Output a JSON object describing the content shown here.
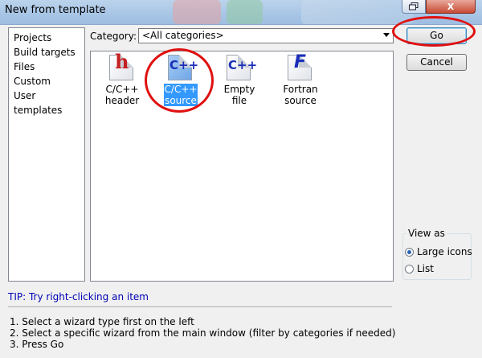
{
  "window": {
    "title": "New from template",
    "close_label": "X"
  },
  "wizard_types": [
    "Projects",
    "Build targets",
    "Files",
    "Custom",
    "User templates"
  ],
  "category": {
    "label": "Category:",
    "value": "<All categories>"
  },
  "templates": [
    {
      "label_l1": "C/C++",
      "label_l2": "header",
      "glyph": "h",
      "icon": "c-header-file-icon"
    },
    {
      "label_l1": "C/C++",
      "label_l2": "source",
      "glyph": "C++",
      "icon": "c-source-file-icon",
      "selected": true
    },
    {
      "label_l1": "Empty file",
      "label_l2": "",
      "glyph": "C++",
      "icon": "empty-file-icon"
    },
    {
      "label_l1": "Fortran",
      "label_l2": "source",
      "glyph": "F",
      "icon": "fortran-file-icon"
    }
  ],
  "buttons": {
    "go": "Go",
    "cancel": "Cancel"
  },
  "view_as": {
    "legend": "View as",
    "large_icons": "Large icons",
    "list": "List",
    "selected": "Large icons"
  },
  "tip": "TIP: Try right-clicking an item",
  "instructions": [
    "1. Select a wizard type first on the left",
    "2. Select a specific wizard from the main window (filter by categories if needed)",
    "3. Press Go"
  ],
  "colors": {
    "selection": "#3399ff",
    "tip": "#0000b5",
    "highlight": "#e01010"
  }
}
